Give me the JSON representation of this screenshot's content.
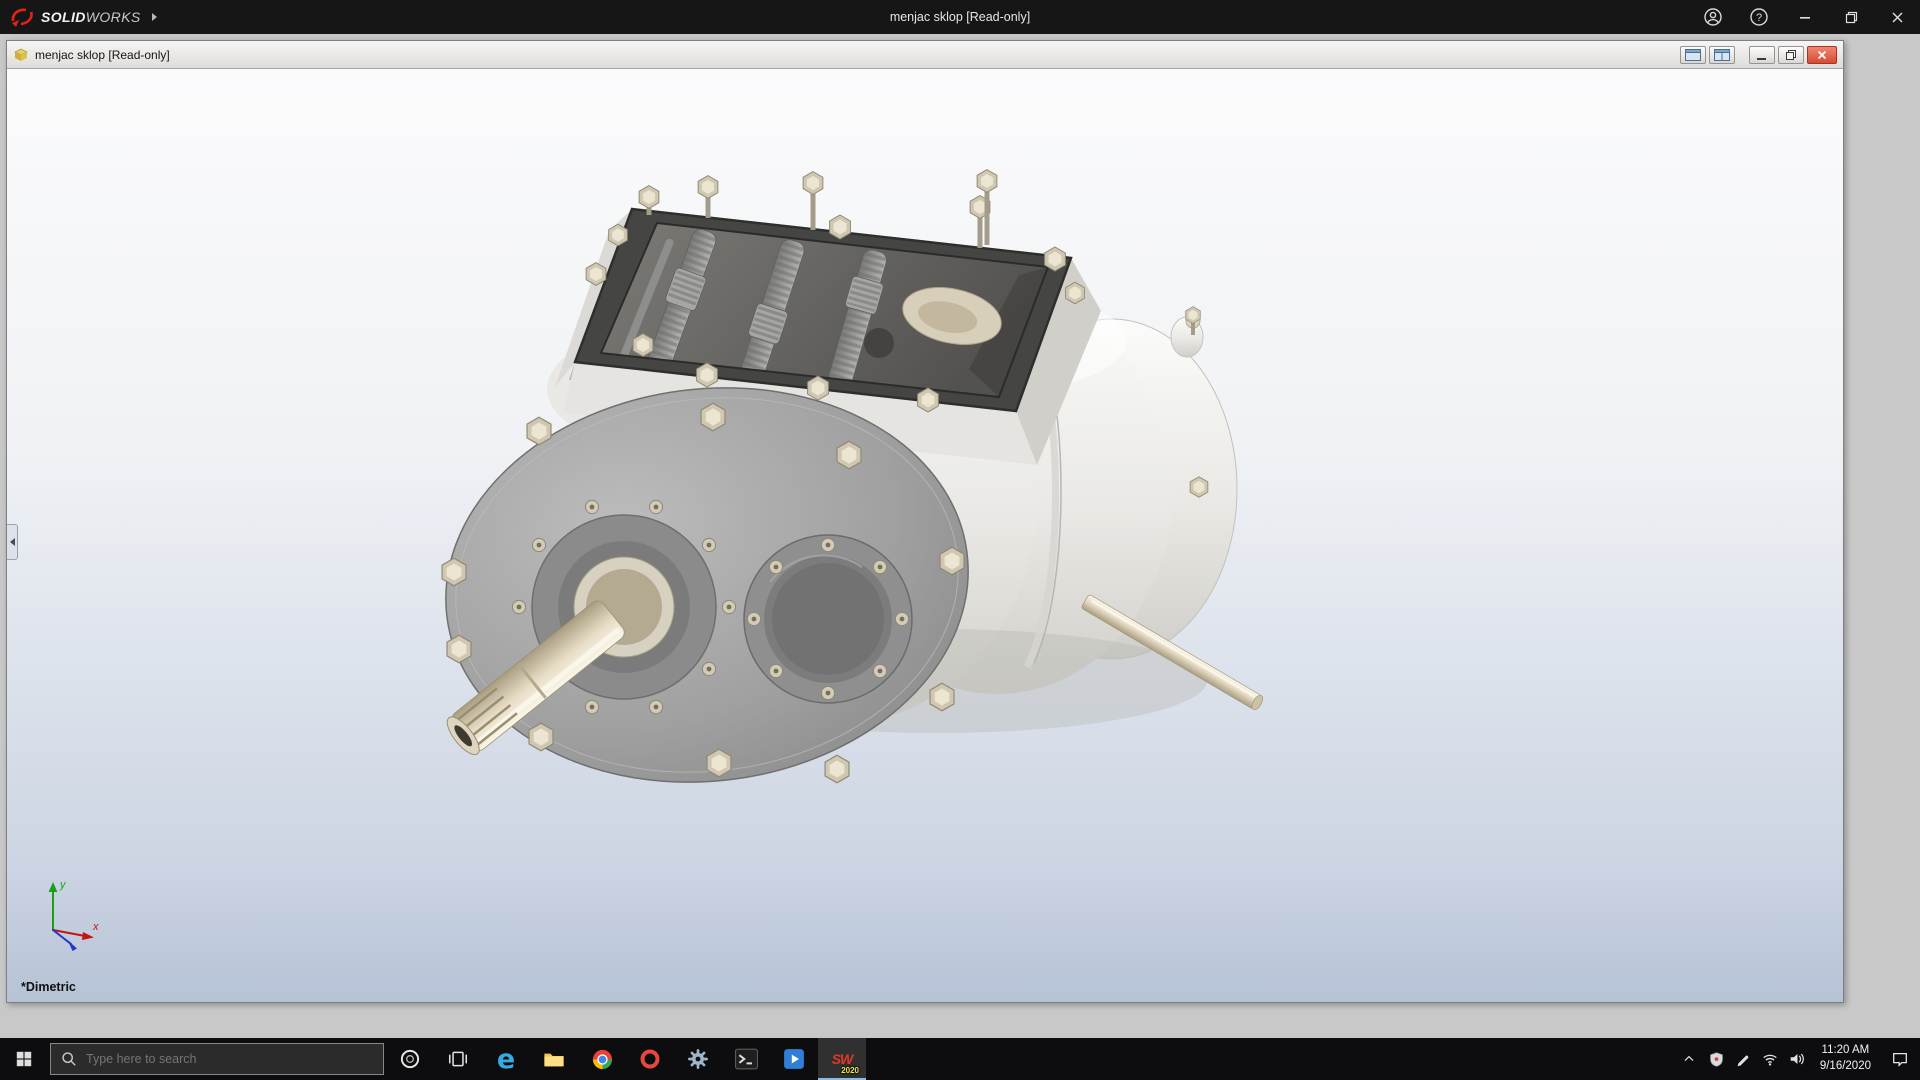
{
  "app": {
    "brand_strong": "SOLID",
    "brand_light": "WORKS",
    "title": "menjac sklop [Read-only]"
  },
  "doc": {
    "title": "menjac sklop [Read-only]"
  },
  "viewport": {
    "view_orientation": "*Dimetric",
    "triad": {
      "x_label": "x",
      "y_label": "y"
    },
    "model_description": "3D shaded gearbox assembly with top cover removed"
  },
  "taskbar": {
    "search_placeholder": "Type here to search",
    "sw_badge": "2020"
  },
  "tray": {
    "time": "11:20 AM",
    "date": "9/16/2020"
  },
  "icons": {
    "solidworks_logo_mark": "red-swoosh",
    "menu_expand": "right-triangle",
    "account": "person-circle",
    "help_glyph": "?",
    "minimize": "–",
    "restore": "overlapping-squares",
    "close_glyph": "×",
    "assembly_doc": "isometric-cube",
    "pane_single": "window-pane",
    "pane_split": "window-pane-split",
    "feature_pane_expander": "left-chevron",
    "start": "windows-logo",
    "search_glyph": "magnifier",
    "cortana": "ring",
    "task_view": "filmstrip",
    "edge_glyph": "e",
    "file_explorer": "folder",
    "chrome": "chrome-wheel",
    "red_app": "red-ring",
    "settings": "gear",
    "command_prompt": "terminal",
    "video_app": "play-button",
    "sw_logo": "SW",
    "tray_expand": "chevron-up",
    "tray_shield": "shield",
    "tray_pen": "pen",
    "tray_network": "wifi",
    "tray_volume": "speaker",
    "notification_center": "speech-bubble"
  },
  "colors": {
    "app_titlebar": "#161616",
    "taskbar": "#0d0d0f",
    "accent_red": "#e2231a",
    "doc_close_button": "#d64a33",
    "viewport_top": "#fbfbfc",
    "viewport_bottom": "#b6c2d6",
    "client_background": "#c8c8c8"
  }
}
